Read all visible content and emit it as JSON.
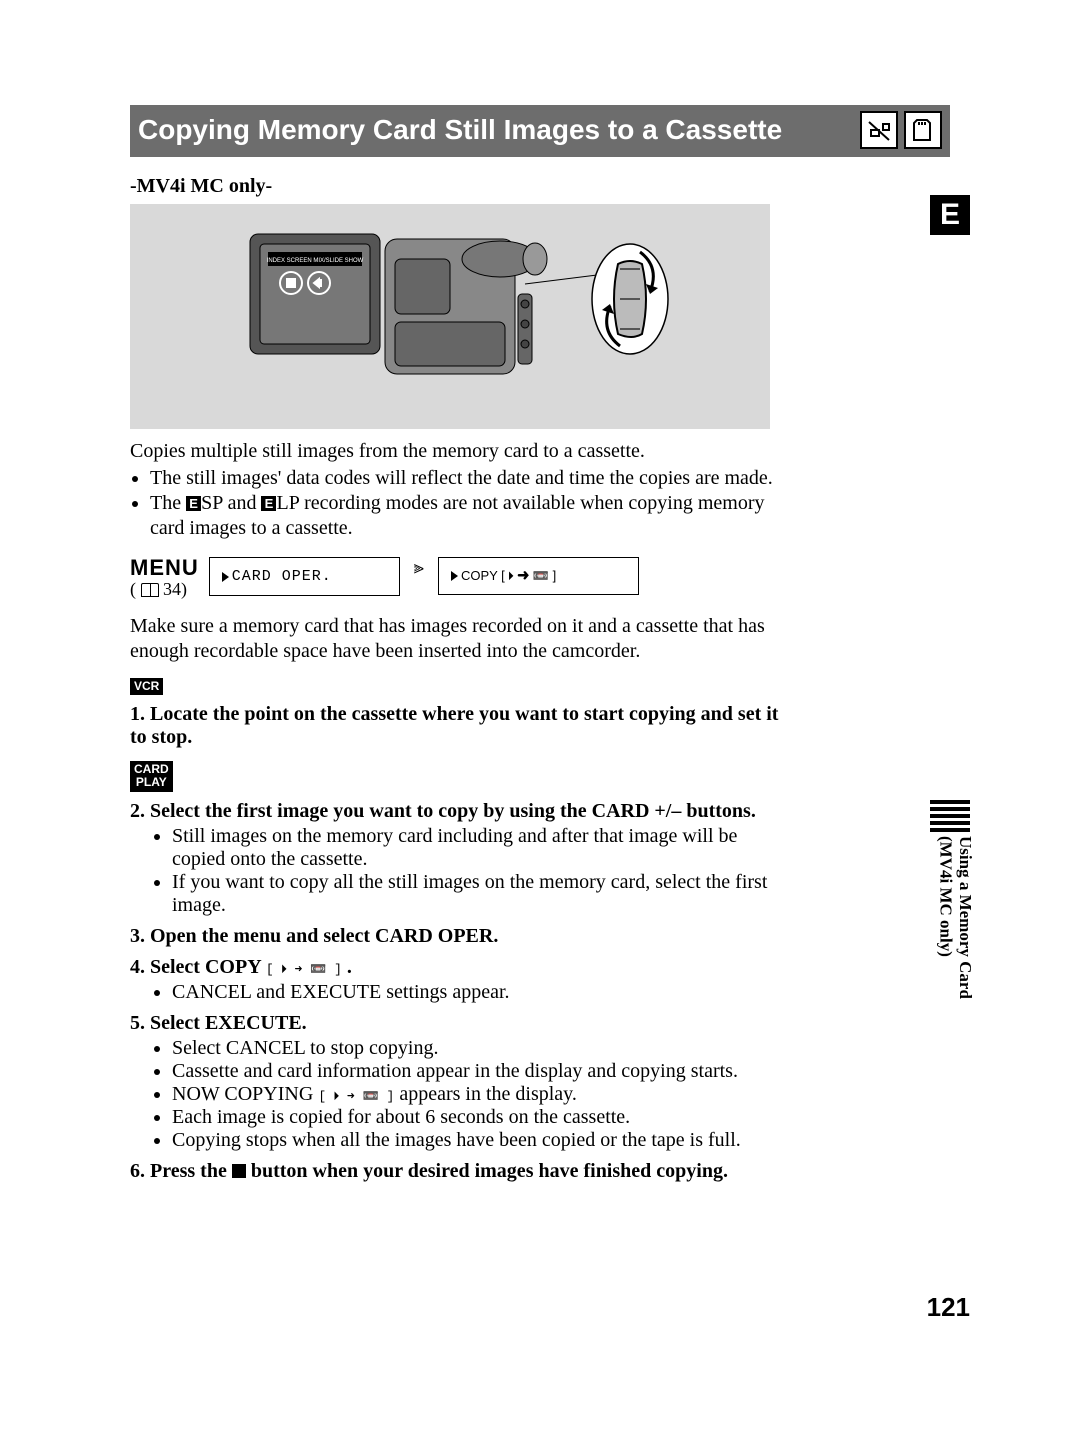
{
  "title": "Copying Memory Card Still Images to a Cassette",
  "subheader": "-MV4i MC only-",
  "illustration_label": "INDEX SCREEN   MIX/SLIDE SHOW",
  "intro": "Copies multiple still images from the memory card to a cassette.",
  "intro_bullets": [
    "The still images' data codes will reflect the date and time the copies are made.",
    "The SP and LP recording modes are not available when copying memory card images to a cassette."
  ],
  "menu": {
    "label": "MENU",
    "ref_page": "34",
    "box1": "CARD OPER.",
    "box2": "COPY [ 🞂 ➜ 📼 ]"
  },
  "pre_steps_note": "Make sure a memory card that has images recorded on it and a cassette that has enough recordable space have been inserted into the camcorder.",
  "mode_vcr": "VCR",
  "mode_cardplay_line1": "CARD",
  "mode_cardplay_line2": "PLAY",
  "steps": {
    "s1": "1. Locate the point on the cassette where you want to start copying and set it to stop.",
    "s2": "2. Select the first image you want to copy by using the CARD +/– buttons.",
    "s2b": [
      "Still images on the memory card including and after that image will be copied onto the cassette.",
      "If you want to copy all the still images on the memory card, select the first image."
    ],
    "s3": "3. Open the menu and select CARD OPER.",
    "s4_pre": "4. Select COPY ",
    "s4_glyph": "[ 🞂 ➜ 📼 ]",
    "s4_post": " .",
    "s4b": [
      "CANCEL and EXECUTE settings appear."
    ],
    "s5": "5. Select EXECUTE.",
    "s5b_1": "Select CANCEL to stop copying.",
    "s5b_2": "Cassette and card information appear in the display and copying starts.",
    "s5b_3_pre": "NOW COPYING ",
    "s5b_3_glyph": "[ 🞂 ➜ 📼 ]",
    "s5b_3_post": " appears in the display.",
    "s5b_4": "Each image is copied for about 6 seconds on the cassette.",
    "s5b_5": "Copying stops when all the images have been copied or the tape is full.",
    "s6_pre": "6. Press the ",
    "s6_post": " button when your desired images have finished copying."
  },
  "side": {
    "e": "E",
    "label_line1": "Using a Memory Card",
    "label_line2": "(MV4i MC only)"
  },
  "page_number": "121"
}
